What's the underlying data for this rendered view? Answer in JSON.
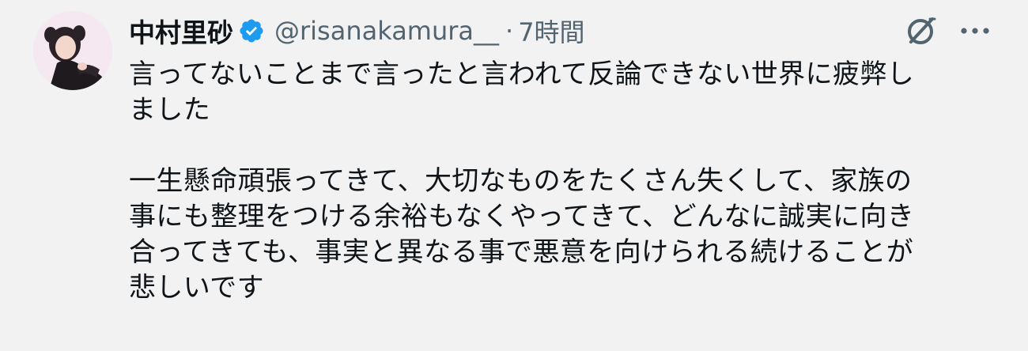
{
  "tweet": {
    "display_name": "中村里砂",
    "handle": "@risanakamura__",
    "separator": "·",
    "time": "7時間",
    "text": "言ってないことまで言ったと言われて反論できない世界に疲弊し\nました\n\n一生懸命頑張ってきて、大切なものをたくさん失くして、家族の\n事にも整理をつける余裕もなくやってきて、どんなに誠実に向き\n合ってきても、事実と異なる事で悪意を向けられる続けることが\n悲しいです"
  },
  "icons": {
    "verified": "verified-badge-icon",
    "grok": "grok-icon",
    "more": "more-options-icon"
  },
  "colors": {
    "background": "#f2f2f2",
    "text": "#0f1419",
    "secondary": "#536471",
    "verified": "#1d9bf0"
  }
}
